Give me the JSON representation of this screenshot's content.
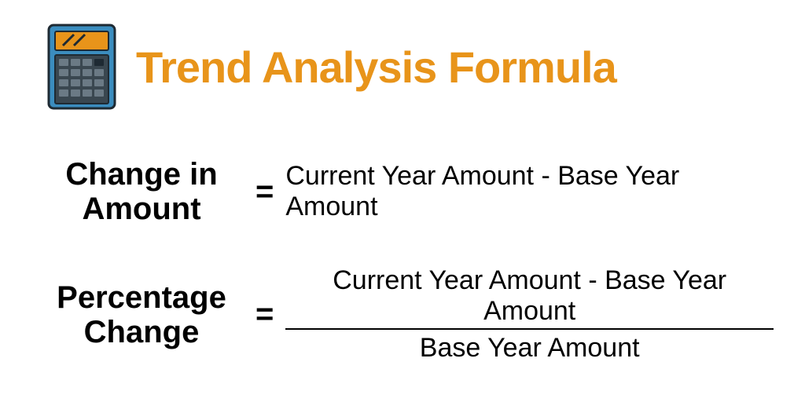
{
  "title": "Trend Analysis Formula",
  "formula1": {
    "label_line1": "Change in",
    "label_line2": "Amount",
    "equals": "=",
    "expression": "Current Year Amount - Base Year Amount"
  },
  "formula2": {
    "label_line1": "Percentage",
    "label_line2": "Change",
    "equals": "=",
    "numerator": "Current Year Amount - Base Year Amount",
    "denominator": "Base Year Amount"
  }
}
